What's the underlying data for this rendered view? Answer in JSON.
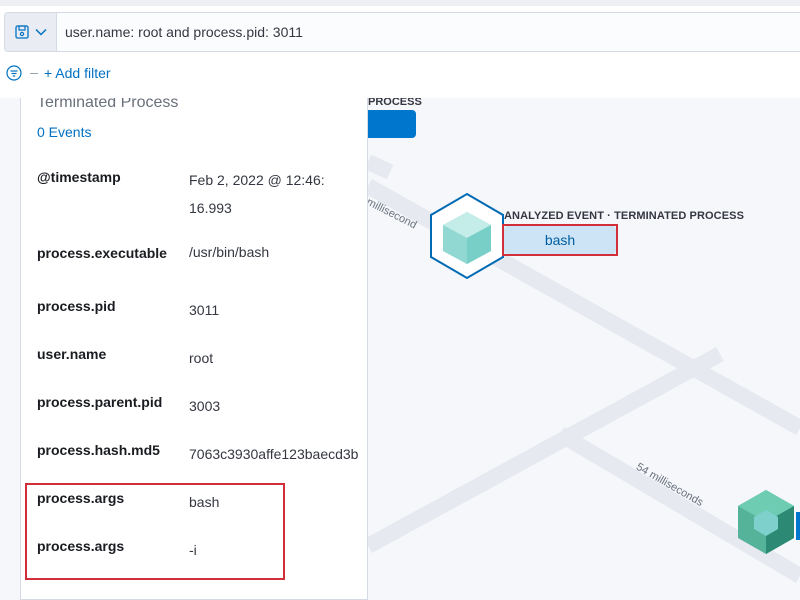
{
  "search": {
    "query": "user.name: root and process.pid: 3011"
  },
  "filters": {
    "add_label": "+ Add filter"
  },
  "panel": {
    "title": "Terminated Process",
    "events_link": "0 Events",
    "rows": [
      {
        "key": "@timestamp",
        "value": "Feb 2, 2022 @ 12:46:\n16.993"
      },
      {
        "key": "process.executable",
        "value": "/usr/bin/bash"
      },
      {
        "key": "process.pid",
        "value": "3011"
      },
      {
        "key": "user.name",
        "value": "root"
      },
      {
        "key": "process.parent.pid",
        "value": "3003"
      },
      {
        "key": "process.hash.md5",
        "value": "7063c3930affe123baecd3b"
      },
      {
        "key": "process.args",
        "value": "bash"
      },
      {
        "key": "process.args",
        "value": "-i"
      }
    ]
  },
  "graph": {
    "partial_node_label": "PROCESS",
    "analyzed_node_label": "ANALYZED EVENT · TERMINATED PROCESS",
    "analyzed_node_name": "bash",
    "edge_label_1": "millisecond",
    "edge_label_2": "54 milliseconds",
    "colors": {
      "node_teal": "#7ed0cc",
      "node_blue": "#006bb4",
      "highlight": "#d32f3a"
    }
  }
}
